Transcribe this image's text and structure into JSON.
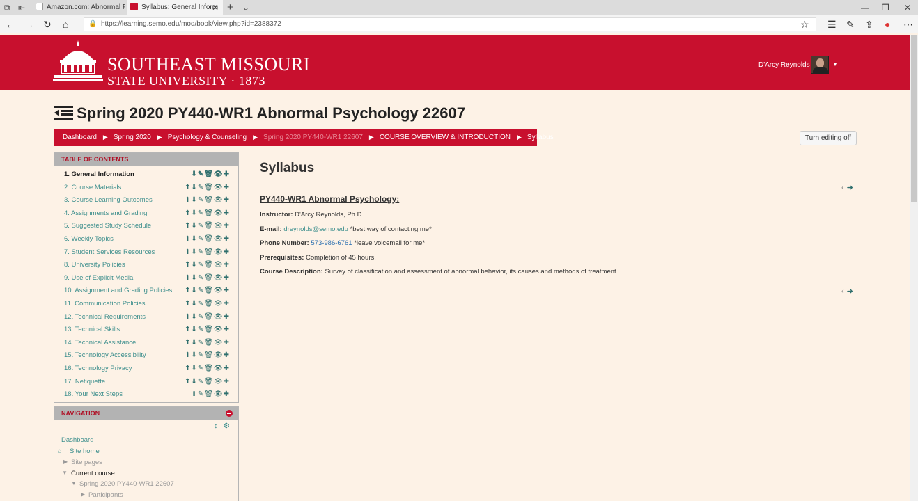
{
  "browser": {
    "tabs": [
      {
        "title": "Amazon.com: Abnormal Psy"
      },
      {
        "title": "Syllabus: General Inform"
      }
    ],
    "url": "https://learning.semo.edu/mod/book/view.php?id=2388372"
  },
  "header": {
    "logo_line1": "SOUTHEAST MISSOURI",
    "logo_line2": "STATE UNIVERSITY · 1873",
    "user_name": "D'Arcy Reynolds"
  },
  "page_title": "Spring 2020 PY440-WR1 Abnormal Psychology 22607",
  "breadcrumb": [
    "Dashboard",
    "Spring 2020",
    "Psychology & Counseling",
    "Spring 2020 PY440-WR1 22607",
    "COURSE OVERVIEW & INTRODUCTION",
    "Syllabus"
  ],
  "edit_button": "Turn editing off",
  "toc": {
    "heading": "TABLE OF CONTENTS",
    "items": [
      "1. General Information",
      "2. Course Materials",
      "3. Course Learning Outcomes",
      "4. Assignments and Grading",
      "5. Suggested Study Schedule",
      "6. Weekly Topics",
      "7. Student Services Resources",
      "8. University Policies",
      "9. Use of Explicit Media",
      "10. Assignment and Grading Policies",
      "11. Communication Policies",
      "12. Technical Requirements",
      "13. Technical Skills",
      "14. Technical Assistance",
      "15. Technology Accessibility",
      "16. Technology Privacy",
      "17. Netiquette",
      "18. Your Next Steps"
    ]
  },
  "navigation": {
    "heading": "NAVIGATION",
    "dashboard": "Dashboard",
    "site_home": "Site home",
    "site_pages": "Site pages",
    "current_course": "Current course",
    "course": "Spring 2020 PY440-WR1 22607",
    "participants": "Participants"
  },
  "content": {
    "title": "Syllabus",
    "course_heading": "PY440-WR1 Abnormal Psychology:",
    "instructor_label": "Instructor:",
    "instructor_value": "D'Arcy Reynolds, Ph.D.",
    "email_label": "E-mail:",
    "email_value": "dreynolds@semo.edu",
    "email_note": "*best way of contacting me*",
    "phone_label": "Phone Number:",
    "phone_value": "573-986-6761",
    "phone_note": "*leave voicemail for me*",
    "prereq_label": "Prerequisites:",
    "prereq_value": "Completion of 45 hours.",
    "desc_label": "Course Description:",
    "desc_value": "Survey of classification and assessment of abnormal behavior, its causes and methods of treatment."
  },
  "colors": {
    "brand_red": "#c8102e",
    "link_teal": "#3d8f8d",
    "page_bg": "#fdf2e6"
  }
}
